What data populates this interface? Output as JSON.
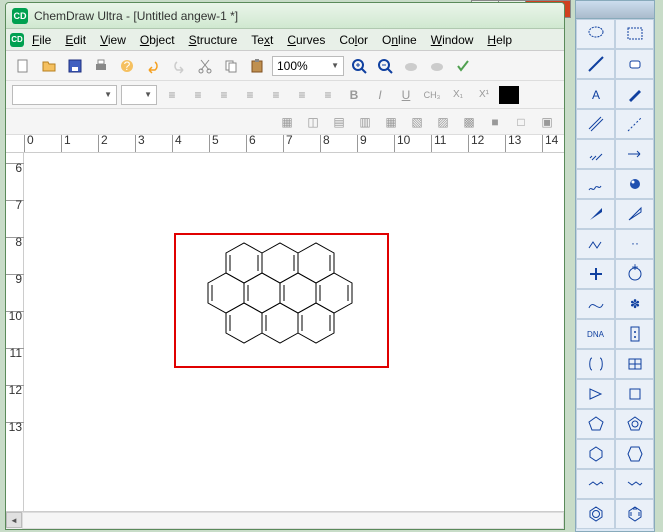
{
  "window": {
    "app_name": "ChemDraw Ultra",
    "doc_title": "[Untitled angew-1 *]"
  },
  "menu": {
    "file": "File",
    "edit": "Edit",
    "view": "View",
    "object": "Object",
    "structure": "Structure",
    "text": "Text",
    "curves": "Curves",
    "color": "Color",
    "online": "Online",
    "window": "Window",
    "help": "Help"
  },
  "toolbar": {
    "zoom": "100%"
  },
  "format": {
    "bold": "B",
    "italic": "I",
    "underline": "U",
    "ch3": "CH₃",
    "sub": "X₁",
    "sup": "X¹"
  },
  "ruler_h": [
    "0",
    "1",
    "2",
    "3",
    "4",
    "5",
    "6",
    "7",
    "8",
    "9",
    "10",
    "11",
    "12",
    "13",
    "14"
  ],
  "ruler_v": [
    "6",
    "7",
    "8",
    "9",
    "10",
    "11",
    "12",
    "13"
  ],
  "palette_label": "DNA",
  "chart_data": null
}
